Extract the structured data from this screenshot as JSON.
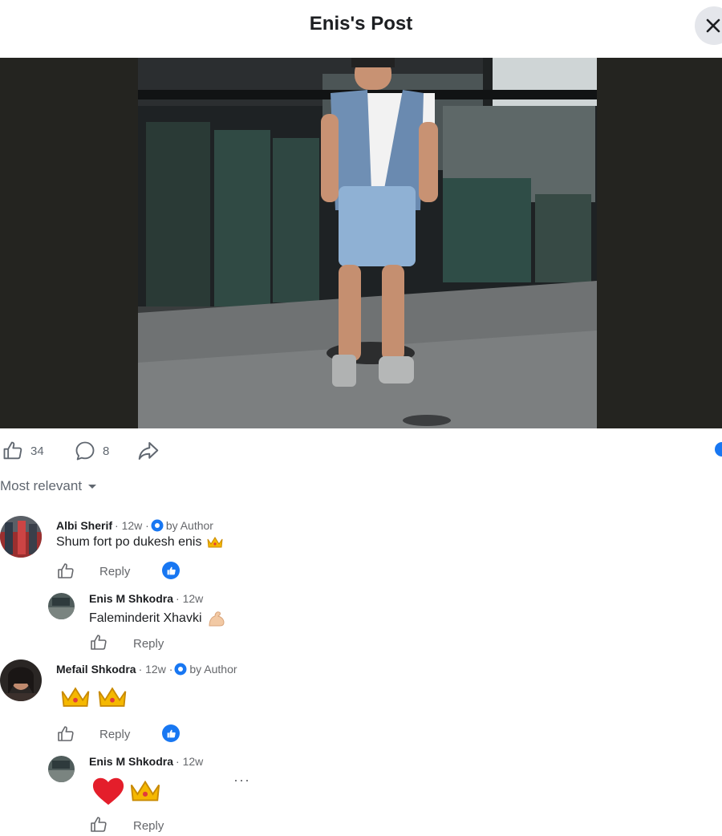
{
  "header": {
    "title": "Enis's Post"
  },
  "post": {
    "likes": "34",
    "comments": "8"
  },
  "sort": {
    "label": "Most relevant"
  },
  "comments": [
    {
      "name": "Albi Sherif",
      "time": "· 12w ·",
      "badge": "by Author",
      "text": "Shum fort po dukesh enis",
      "reply_label": "Reply",
      "replies": [
        {
          "name": "Enis M Shkodra",
          "time": "· 12w",
          "text": "Faleminderit Xhavki",
          "reply_label": "Reply"
        }
      ]
    },
    {
      "name": "Mefail Shkodra",
      "time": "· 12w ·",
      "badge": "by Author",
      "text": "",
      "reply_label": "Reply",
      "replies": [
        {
          "name": "Enis M Shkodra",
          "time": "· 12w",
          "text": "",
          "reply_label": "Reply",
          "more": "···"
        }
      ]
    }
  ],
  "colors": {
    "accent": "#1877f2",
    "secondary_text": "#65676b",
    "photo_bg": "#242420"
  }
}
